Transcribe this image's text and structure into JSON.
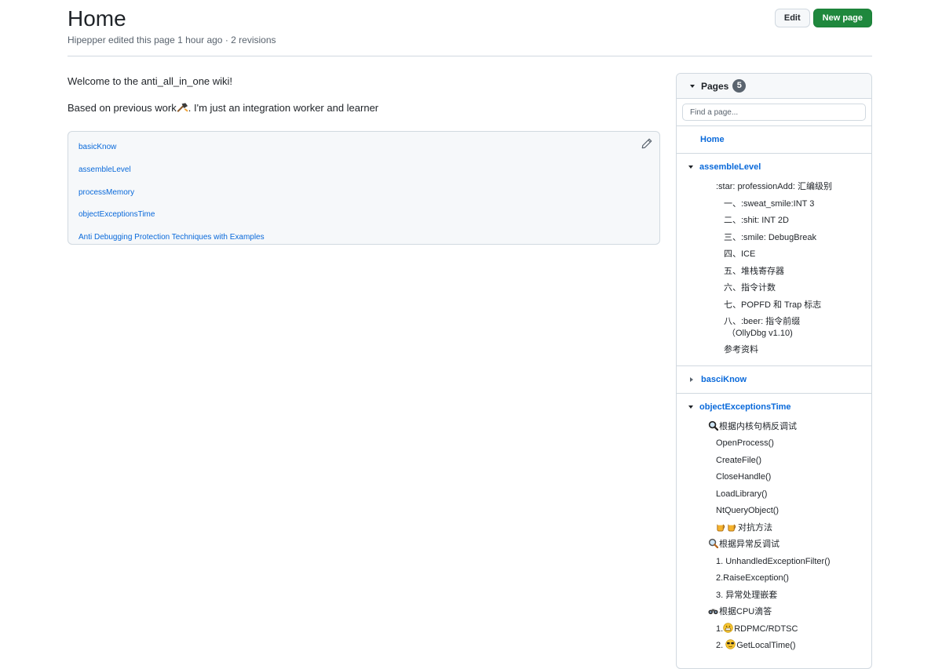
{
  "header": {
    "title": "Home",
    "meta": "Hipepper edited this page 1 hour ago · 2 revisions",
    "edit_label": "Edit",
    "new_page_label": "New page"
  },
  "main": {
    "welcome": "Welcome to the anti_all_in_one wiki!",
    "based_pre": "Based on previous work",
    "based_post": ". I'm just an integration worker and learner",
    "links": [
      "basicKnow",
      "assembleLevel",
      "processMemory",
      "objectExceptionsTime",
      "Anti Debugging Protection Techniques with Examples"
    ]
  },
  "sidebar": {
    "title": "Pages",
    "count": "5",
    "search_placeholder": "Find a page...",
    "home": "Home",
    "assemble": {
      "title": "assembleLevel",
      "items": [
        ":star: professionAdd: 汇编级别",
        "一、:sweat_smile:INT 3",
        "二、:shit: INT 2D",
        "三、:smile: DebugBreak",
        "四、ICE",
        "五、堆栈寄存器",
        "六、指令计数",
        "七、POPFD 和 Trap 标志",
        "八、:beer: 指令前缀",
        "（OllyDbg v1.10)",
        "参考资料"
      ]
    },
    "basic": {
      "title": "basciKnow"
    },
    "object": {
      "title": "objectExceptionsTime",
      "items": [
        "根据内核句柄反调试",
        "OpenProcess()",
        "CreateFile()",
        "CloseHandle()",
        "LoadLibrary()",
        "NtQueryObject()",
        "对抗方法",
        "根据异常反调试",
        "1. UnhandledExceptionFilter()",
        "2.RaiseException()",
        "3. 异常处理嵌套",
        "根据CPU滴答",
        "1.",
        "RDPMC/RDTSC",
        "2.",
        "GetLocalTime()"
      ]
    }
  }
}
